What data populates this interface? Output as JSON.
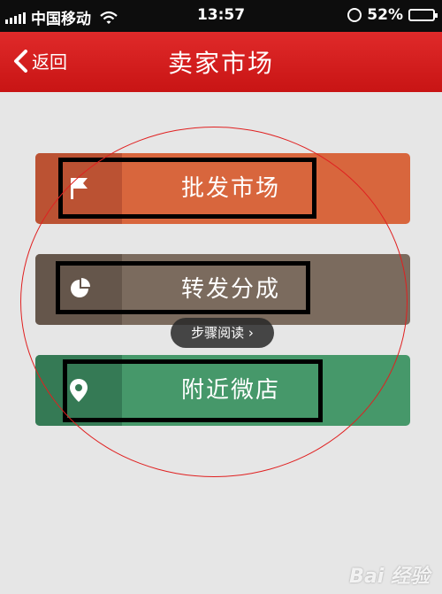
{
  "status_bar": {
    "carrier": "中国移动",
    "time": "13:57",
    "battery": "52%",
    "battery_level": 0.52
  },
  "nav": {
    "back_label": "返回",
    "title": "卖家市场"
  },
  "menu": [
    {
      "label": "批发市场",
      "icon": "flag-icon",
      "color": "#d8663d"
    },
    {
      "label": "转发分成",
      "icon": "pie-chart-icon",
      "color": "#7b6b5e"
    },
    {
      "label": "附近微店",
      "icon": "location-pin-icon",
      "color": "#46986a"
    }
  ],
  "steps_pill": {
    "label": "步骤阅读 ›"
  },
  "watermark": {
    "text": "Bai  经验"
  }
}
